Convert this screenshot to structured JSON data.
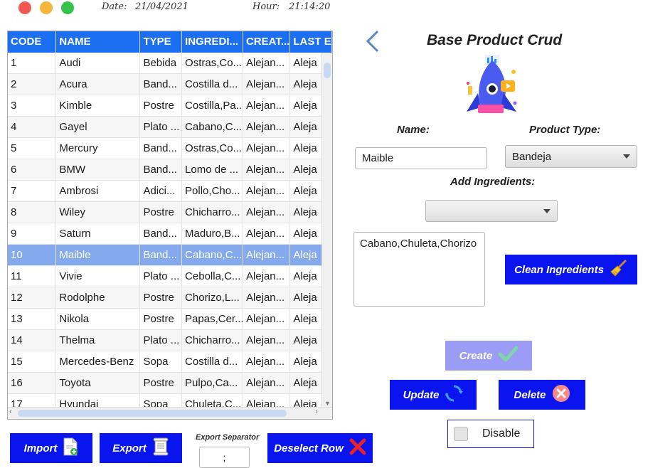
{
  "header": {
    "date_label": "Date:",
    "date_value": "21/04/2021",
    "hour_label": "Hour:",
    "hour_value": "21:14:20"
  },
  "table": {
    "columns": [
      "CODE",
      "NAME",
      "TYPE",
      "INGREDI...",
      "CREAT...",
      "LAST E"
    ],
    "selected_row_index": 9,
    "rows": [
      [
        "1",
        "Audi",
        "Bebida",
        "Ostras,Co...",
        "Alejan...",
        "Aleja"
      ],
      [
        "2",
        "Acura",
        "Band...",
        "Costilla d...",
        "Alejan...",
        "Aleja"
      ],
      [
        "3",
        "Kimble",
        "Postre",
        "Costilla,Pa...",
        "Alejan...",
        "Aleja"
      ],
      [
        "4",
        "Gayel",
        "Plato ...",
        "Cabano,C...",
        "Alejan...",
        "Aleja"
      ],
      [
        "5",
        "Mercury",
        "Band...",
        "Ostras,Co...",
        "Alejan...",
        "Aleja"
      ],
      [
        "6",
        "BMW",
        "Band...",
        "Lomo de ...",
        "Alejan...",
        "Aleja"
      ],
      [
        "7",
        "Ambrosi",
        "Adici...",
        "Pollo,Cho...",
        "Alejan...",
        "Aleja"
      ],
      [
        "8",
        "Wiley",
        "Postre",
        "Chicharro...",
        "Alejan...",
        "Aleja"
      ],
      [
        "9",
        "Saturn",
        "Band...",
        "Maduro,B...",
        "Alejan...",
        "Aleja"
      ],
      [
        "10",
        "Maible",
        "Band...",
        "Cabano,C...",
        "Alejan...",
        "Aleja"
      ],
      [
        "11",
        "Vivie",
        "Plato ...",
        "Cebolla,C...",
        "Alejan...",
        "Aleja"
      ],
      [
        "12",
        "Rodolphe",
        "Postre",
        "Chorizo,L...",
        "Alejan...",
        "Aleja"
      ],
      [
        "13",
        "Nikola",
        "Postre",
        "Papas,Cer...",
        "Alejan...",
        "Aleja"
      ],
      [
        "14",
        "Thelma",
        "Plato ...",
        "Chicharro...",
        "Alejan...",
        "Aleja"
      ],
      [
        "15",
        "Mercedes-Benz",
        "Sopa",
        "Costilla d...",
        "Alejan...",
        "Aleja"
      ],
      [
        "16",
        "Toyota",
        "Postre",
        "Pulpo,Ca...",
        "Alejan...",
        "Aleja"
      ],
      [
        "17",
        "Hyundai",
        "Sopa",
        "Chuleta,C...",
        "Alejan...",
        "Aleja"
      ]
    ]
  },
  "bottom": {
    "import_label": "Import",
    "export_label": "Export",
    "separator_label": "Export Separator",
    "separator_value": ";",
    "deselect_label": "Deselect Row"
  },
  "form": {
    "title": "Base Product Crud",
    "name_label": "Name:",
    "name_value": "Maible",
    "type_label": "Product Type:",
    "type_value": "Bandeja",
    "ingredients_label": "Add Ingredients:",
    "ingredients_combo_value": "",
    "ingredients_text": "Cabano,Chuleta,Chorizo",
    "clean_label": "Clean Ingredients",
    "create_label": "Create",
    "update_label": "Update",
    "delete_label": "Delete",
    "disable_label": "Disable",
    "colors": {
      "button_blue": "#0a14ee",
      "button_disabled": "#9a9cf6",
      "header_blue": "#1c6ff0",
      "selected_row": "#84a9ec"
    }
  }
}
